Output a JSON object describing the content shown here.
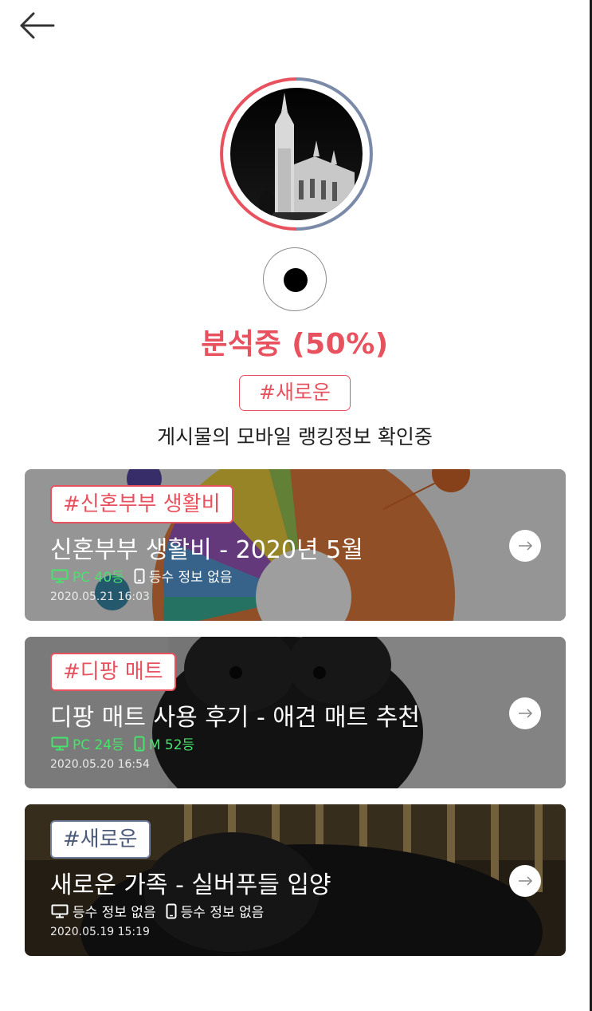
{
  "header": {
    "back_icon": "arrow-left-icon"
  },
  "profile": {
    "ring_colors": [
      "#e8525f",
      "#7a8aa8"
    ]
  },
  "analysis": {
    "status_text": "분석중 (50%)",
    "progress_percent": 50,
    "current_tag": "#새로운",
    "subtitle": "게시물의 모바일 랭킹정보 확인중"
  },
  "posts": [
    {
      "tag": "#신혼부부 생활비",
      "title": "신혼부부 생활비 - 2020년 5월",
      "pc_rank": "PC 40등",
      "mobile_rank": "등수 정보 없음",
      "date": "2020.05.21 16:03"
    },
    {
      "tag": "#디팡 매트",
      "title": "디팡 매트 사용 후기 - 애견 매트 추천",
      "pc_rank": "PC 24등",
      "mobile_rank": "M 52등",
      "date": "2020.05.20 16:54"
    },
    {
      "tag": "#새로운",
      "title": "새로운 가족 - 실버푸들 입양",
      "pc_rank": "등수 정보 없음",
      "mobile_rank": "등수 정보 없음",
      "date": "2020.05.19 15:19"
    }
  ],
  "colors": {
    "accent": "#e8525f",
    "rank_green": "#46e46a",
    "tag_blue": "#6f7f9e"
  }
}
